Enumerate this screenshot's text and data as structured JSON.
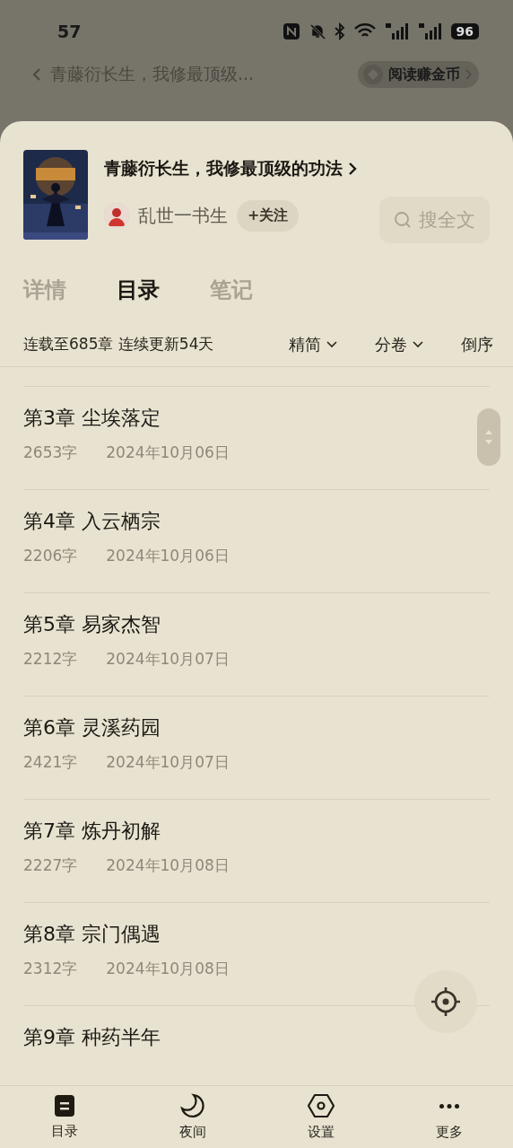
{
  "status_bar": {
    "time": "57",
    "battery": "96"
  },
  "top_bar": {
    "title": "青藤衍长生，我修最顶级...",
    "reward_button": "阅读赚金币"
  },
  "book": {
    "title": "青藤衍长生，我修最顶级的功法",
    "author": "乱世一书生",
    "follow_button": "+关注",
    "search_button": "搜全文"
  },
  "tabs": [
    {
      "label": "详情",
      "selected": false
    },
    {
      "label": "目录",
      "selected": true
    },
    {
      "label": "笔记",
      "selected": false
    }
  ],
  "catalog_info": {
    "summary": "连载至685章 连续更新54天",
    "filters": [
      "精简",
      "分卷"
    ],
    "sort": "倒序"
  },
  "chapters": [
    {
      "title": "第3章 尘埃落定",
      "words": "2653字",
      "date": "2024年10月06日"
    },
    {
      "title": "第4章 入云栖宗",
      "words": "2206字",
      "date": "2024年10月06日"
    },
    {
      "title": "第5章 易家杰智",
      "words": "2212字",
      "date": "2024年10月07日"
    },
    {
      "title": "第6章 灵溪药园",
      "words": "2421字",
      "date": "2024年10月07日"
    },
    {
      "title": "第7章 炼丹初解",
      "words": "2227字",
      "date": "2024年10月08日"
    },
    {
      "title": "第8章 宗门偶遇",
      "words": "2312字",
      "date": "2024年10月08日"
    },
    {
      "title": "第9章 种药半年"
    }
  ],
  "bottom_nav": [
    {
      "kind": "catalog",
      "label": "目录"
    },
    {
      "kind": "night",
      "label": "夜间"
    },
    {
      "kind": "settings",
      "label": "设置"
    },
    {
      "kind": "more",
      "label": "更多"
    }
  ]
}
